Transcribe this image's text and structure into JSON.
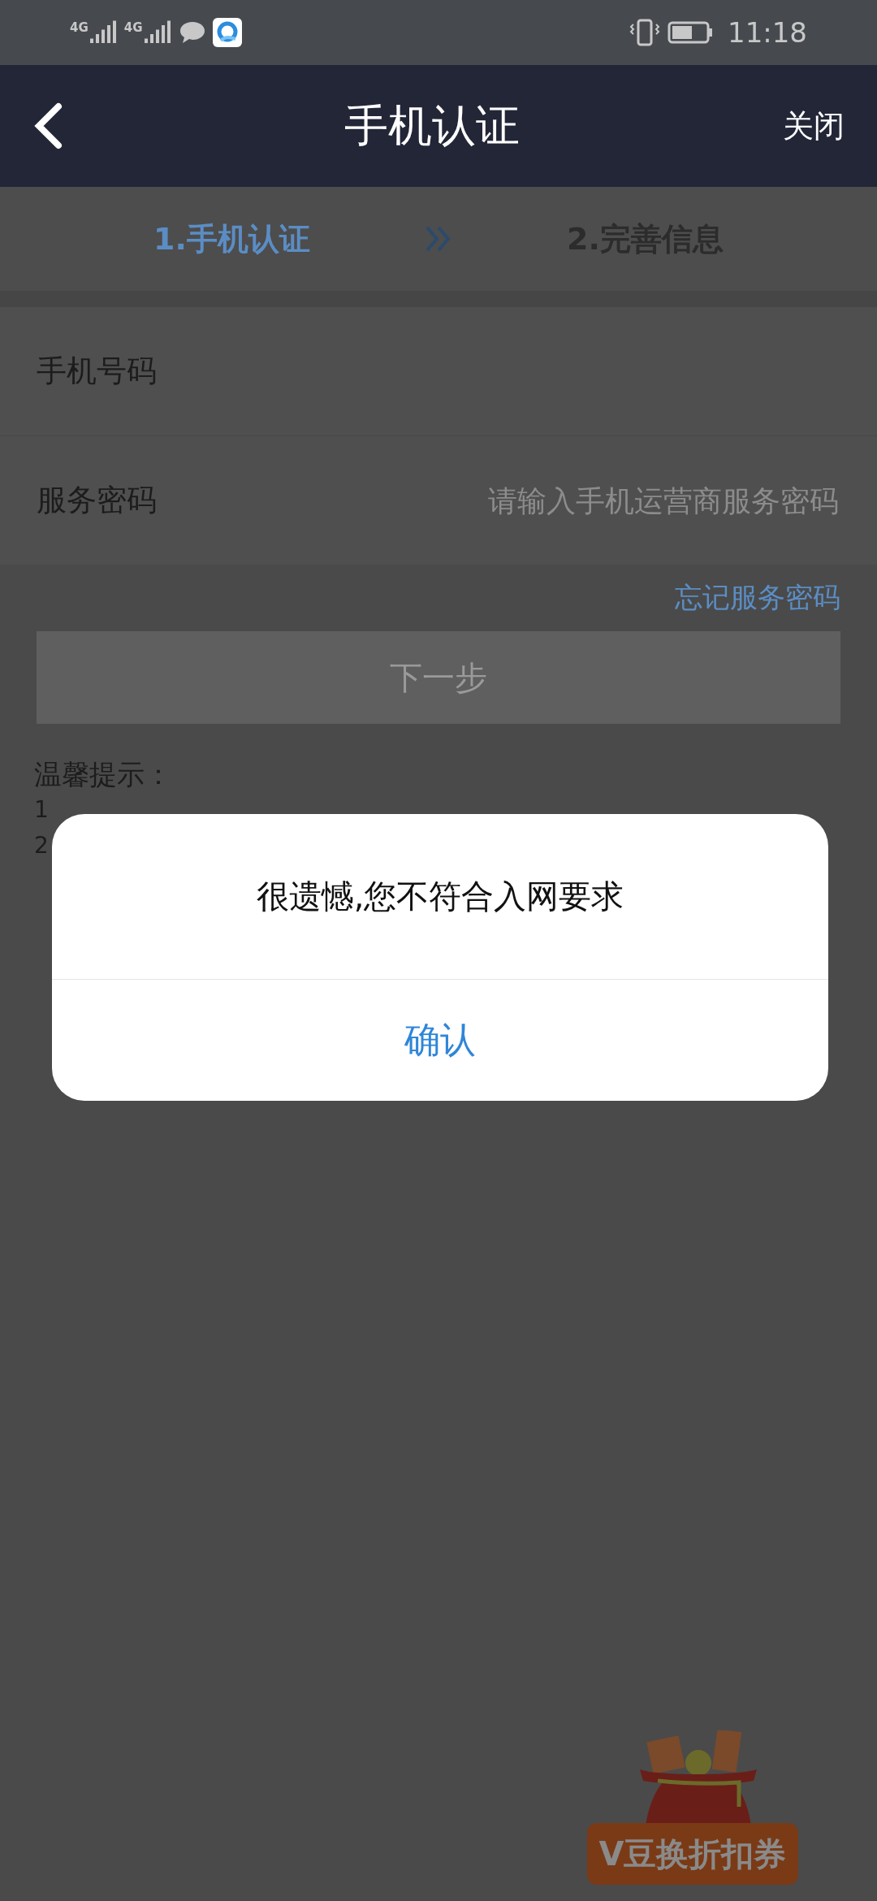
{
  "status_bar": {
    "network_labels": [
      "4G",
      "4G"
    ],
    "time": "11:18"
  },
  "header": {
    "title": "手机认证",
    "close": "关闭"
  },
  "steps": [
    {
      "label": "1.手机认证",
      "selected": true
    },
    {
      "label": "2.完善信息",
      "selected": false
    }
  ],
  "form": [
    {
      "label": "手机号码"
    },
    {
      "label": "服务密码",
      "placeholder": "请输入手机运营商服务密码"
    }
  ],
  "forgot_link": "忘记服务密码",
  "next_button": {
    "label": "下一步",
    "disabled": true
  },
  "tips": {
    "title": "温馨提示：",
    "lines": [
      "1",
      "2"
    ]
  },
  "dialog": {
    "message": "很遗憾,您不符合入网要求",
    "confirm": "确认"
  },
  "promo": {
    "label": "V豆换折扣券"
  }
}
